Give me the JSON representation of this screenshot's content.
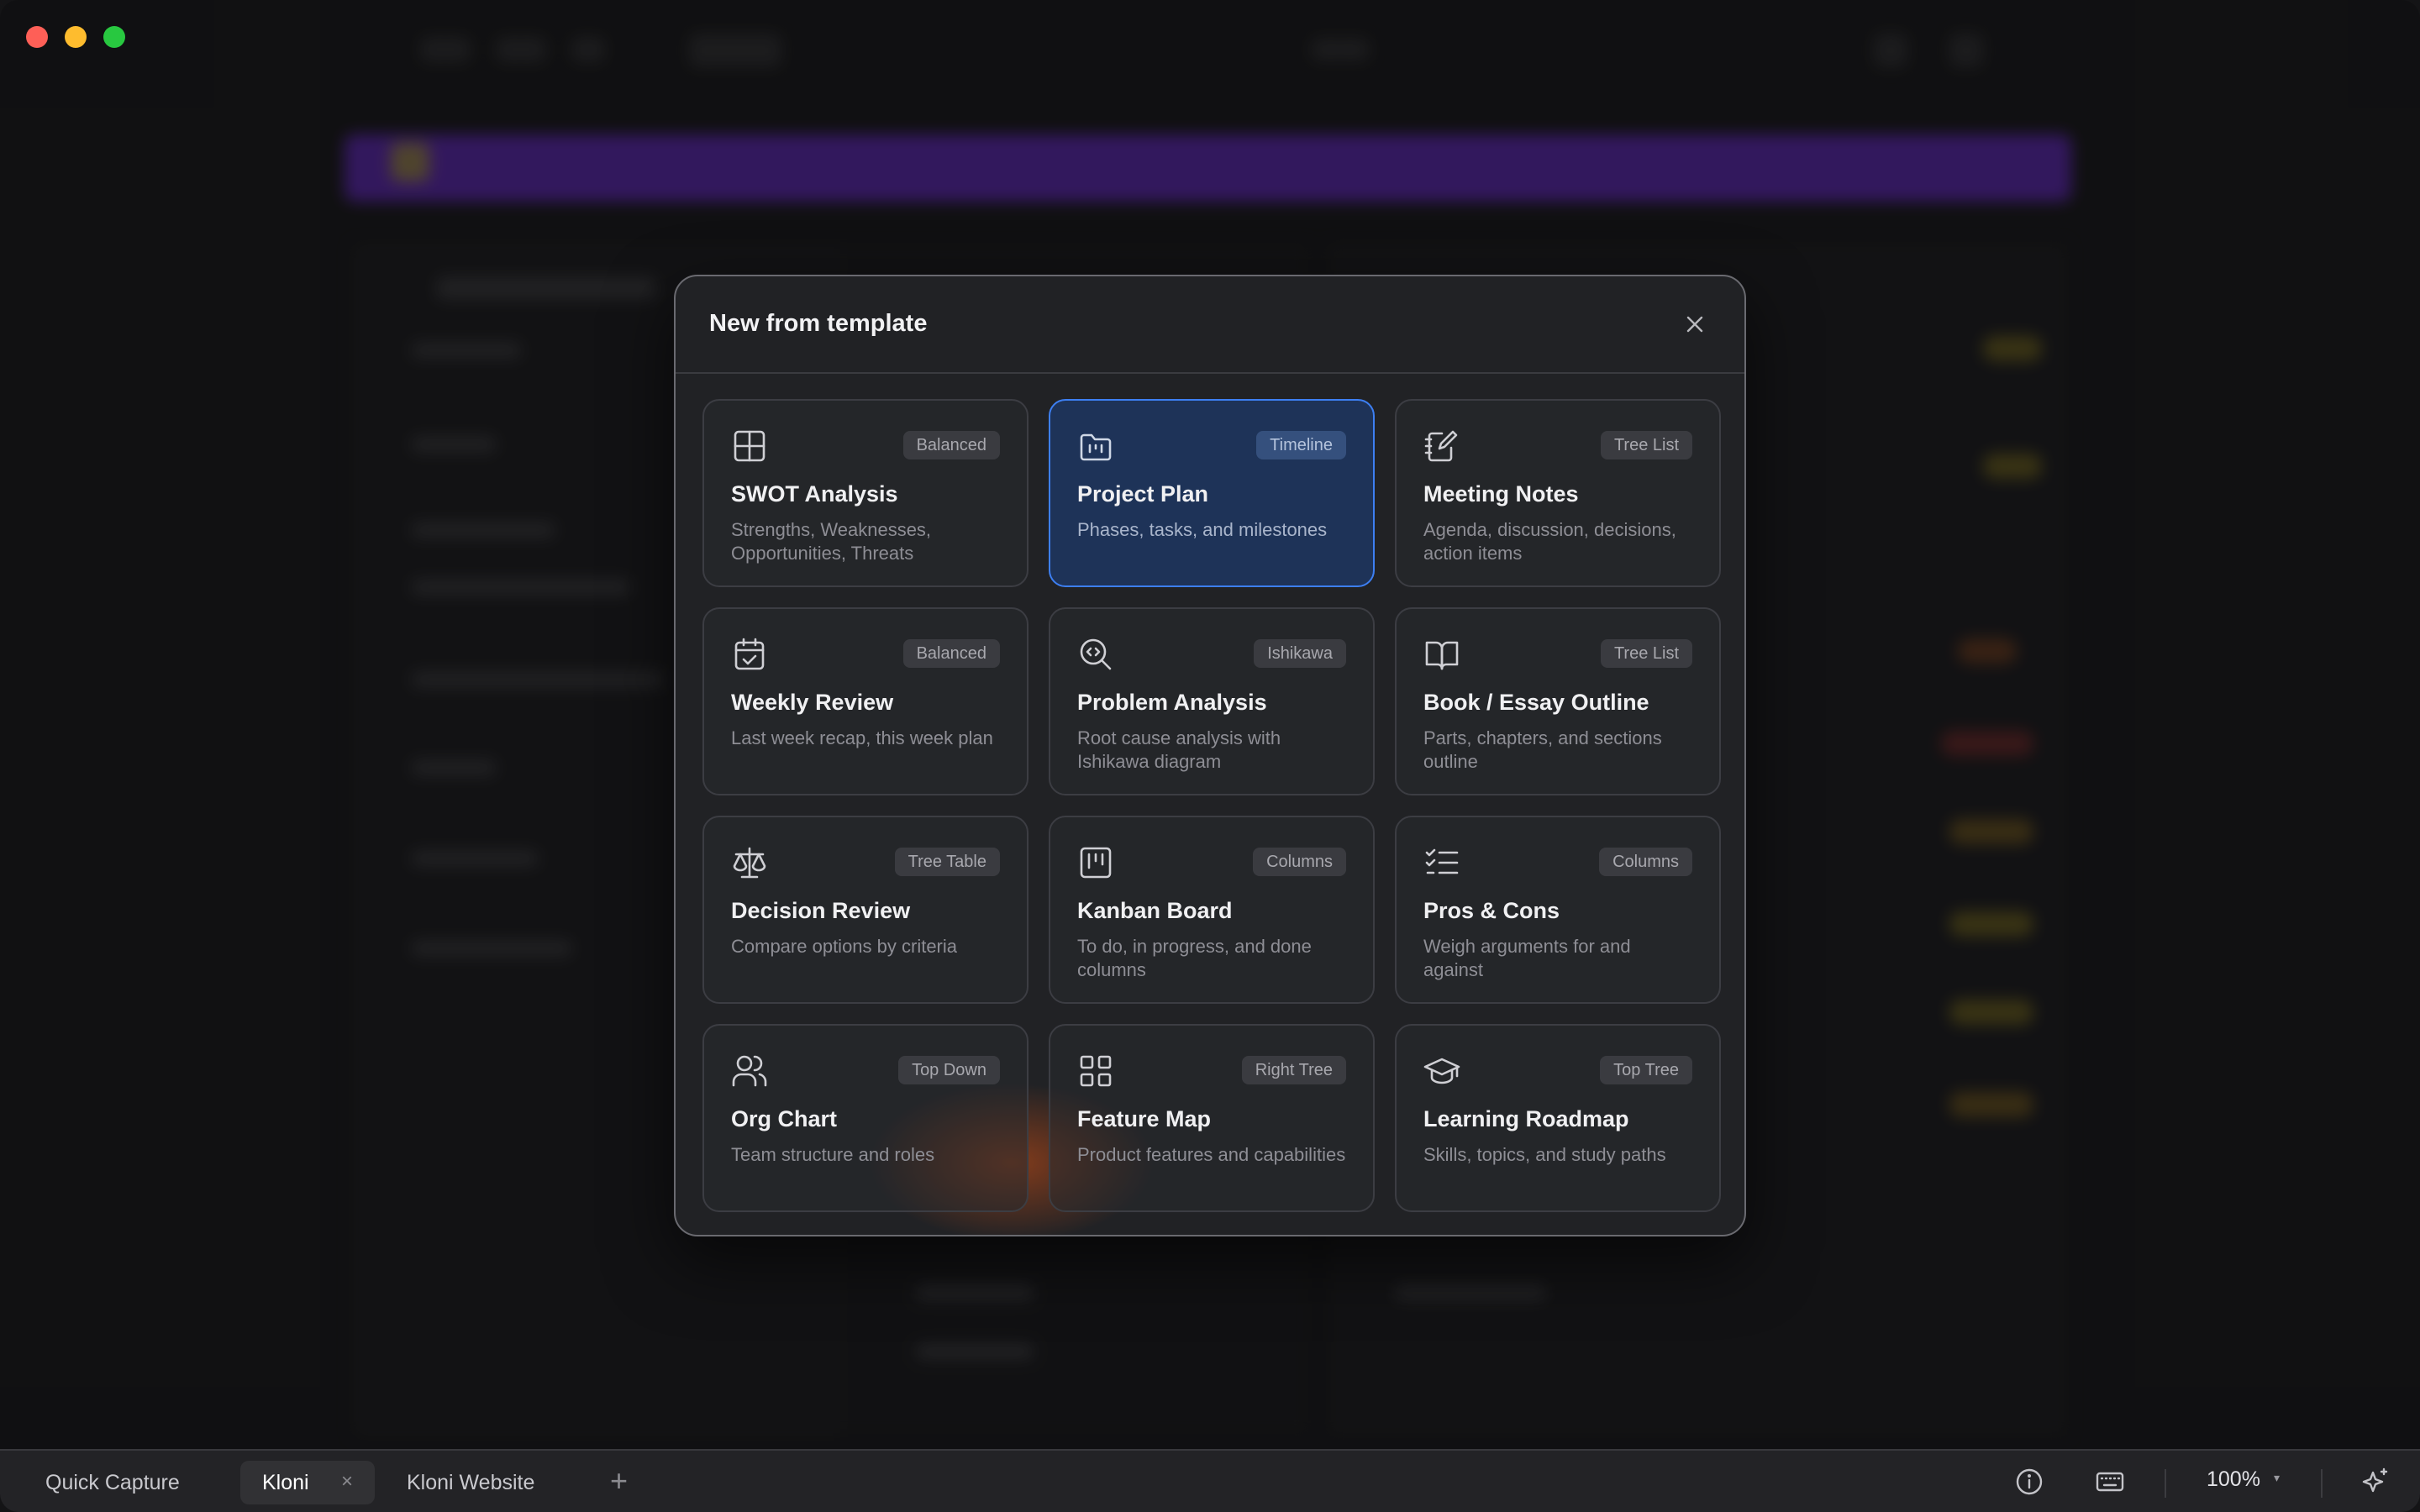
{
  "dialog": {
    "title": "New from template",
    "templates": [
      {
        "icon": "grid-icon",
        "badge": "Balanced",
        "name": "SWOT Analysis",
        "description": "Strengths, Weaknesses, Opportunities, Threats",
        "selected": false
      },
      {
        "icon": "folder-chart-icon",
        "badge": "Timeline",
        "name": "Project Plan",
        "description": "Phases, tasks, and milestones",
        "selected": true
      },
      {
        "icon": "notebook-pen-icon",
        "badge": "Tree List",
        "name": "Meeting Notes",
        "description": "Agenda, discussion, decisions, action items",
        "selected": false
      },
      {
        "icon": "calendar-check-icon",
        "badge": "Balanced",
        "name": "Weekly Review",
        "description": "Last week recap, this week plan",
        "selected": false
      },
      {
        "icon": "search-code-icon",
        "badge": "Ishikawa",
        "name": "Problem Analysis",
        "description": "Root cause analysis with Ishikawa diagram",
        "selected": false
      },
      {
        "icon": "open-book-icon",
        "badge": "Tree List",
        "name": "Book / Essay Outline",
        "description": "Parts, chapters, and sections outline",
        "selected": false
      },
      {
        "icon": "scale-icon",
        "badge": "Tree Table",
        "name": "Decision Review",
        "description": "Compare options by criteria",
        "selected": false
      },
      {
        "icon": "kanban-icon",
        "badge": "Columns",
        "name": "Kanban Board",
        "description": "To do, in progress, and done columns",
        "selected": false
      },
      {
        "icon": "checklist-icon",
        "badge": "Columns",
        "name": "Pros & Cons",
        "description": "Weigh arguments for and against",
        "selected": false
      },
      {
        "icon": "users-icon",
        "badge": "Top Down",
        "name": "Org Chart",
        "description": "Team structure and roles",
        "selected": false
      },
      {
        "icon": "layout-grid-icon",
        "badge": "Right Tree",
        "name": "Feature Map",
        "description": "Product features and capabilities",
        "selected": false
      },
      {
        "icon": "graduation-cap-icon",
        "badge": "Top Tree",
        "name": "Learning Roadmap",
        "description": "Skills, topics, and study paths",
        "selected": false
      }
    ]
  },
  "tabbar": {
    "tabs": [
      {
        "label": "Quick Capture",
        "active": false
      },
      {
        "label": "Kloni",
        "active": true
      },
      {
        "label": "Kloni Website",
        "active": false
      }
    ],
    "add_tab": "+",
    "close_glyph": "×",
    "zoom": "100%",
    "zoom_caret": "▾"
  },
  "colors": {
    "accent": "#3d7ff2",
    "banner": "#7a2ff0",
    "traffic_red": "#fe5f57",
    "traffic_yellow": "#febc2e",
    "traffic_green": "#28c840"
  }
}
